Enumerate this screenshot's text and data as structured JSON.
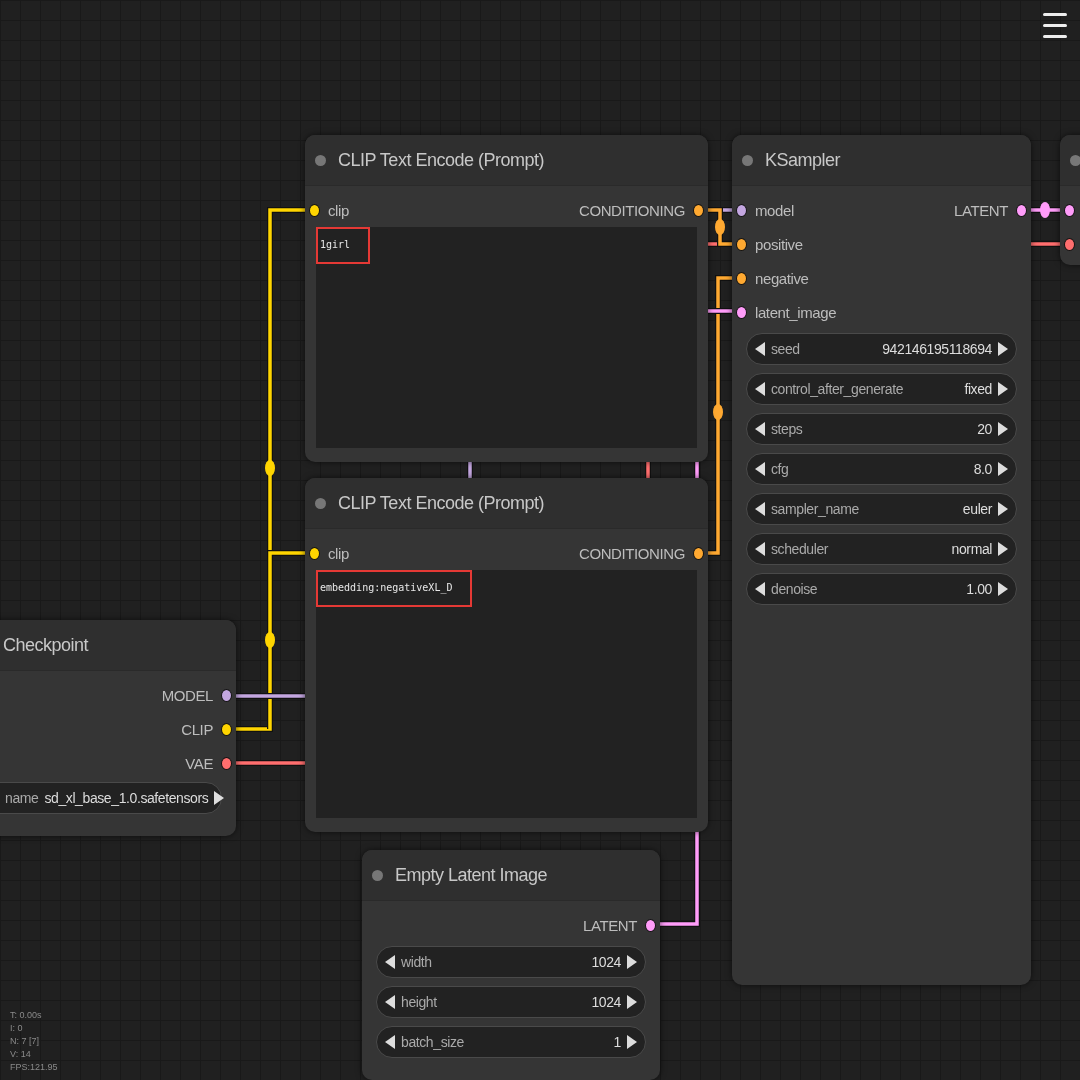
{
  "nodes": [
    {
      "title": "Checkpoint",
      "kind": "loader",
      "outputs": [
        {
          "name": "MODEL",
          "color": "#c3a6e0"
        },
        {
          "name": "CLIP",
          "color": "#ffd500"
        },
        {
          "name": "VAE",
          "color": "#ff6e6e"
        }
      ],
      "widgets": [
        {
          "label": "name",
          "value": "sd_xl_base_1.0.safetensors"
        }
      ]
    },
    {
      "title": "CLIP Text Encode (Prompt)",
      "kind": "prompt",
      "inputs": [
        {
          "name": "clip",
          "color": "#ffd500"
        }
      ],
      "outputs": [
        {
          "name": "CONDITIONING",
          "color": "#ffa931"
        }
      ],
      "text": "1girl",
      "highlighted": true
    },
    {
      "title": "CLIP Text Encode (Prompt)",
      "kind": "prompt",
      "inputs": [
        {
          "name": "clip",
          "color": "#ffd500"
        }
      ],
      "outputs": [
        {
          "name": "CONDITIONING",
          "color": "#ffa931"
        }
      ],
      "text": "embedding:negativeXL_D",
      "highlighted": true
    },
    {
      "title": "Empty Latent Image",
      "kind": "widgets",
      "outputs": [
        {
          "name": "LATENT",
          "color": "#ff9cf9"
        }
      ],
      "widgets": [
        {
          "label": "width",
          "value": "1024"
        },
        {
          "label": "height",
          "value": "1024"
        },
        {
          "label": "batch_size",
          "value": "1"
        }
      ]
    },
    {
      "title": "KSampler",
      "kind": "widgets",
      "inputs": [
        {
          "name": "model",
          "color": "#c3a6e0"
        },
        {
          "name": "positive",
          "color": "#ffa931"
        },
        {
          "name": "negative",
          "color": "#ffa931"
        },
        {
          "name": "latent_image",
          "color": "#ff9cf9"
        }
      ],
      "outputs": [
        {
          "name": "LATENT",
          "color": "#ff9cf9"
        }
      ],
      "widgets": [
        {
          "label": "seed",
          "value": "942146195118694"
        },
        {
          "label": "control_after_generate",
          "value": "fixed"
        },
        {
          "label": "steps",
          "value": "20"
        },
        {
          "label": "cfg",
          "value": "8.0"
        },
        {
          "label": "sampler_name",
          "value": "euler"
        },
        {
          "label": "scheduler",
          "value": "normal"
        },
        {
          "label": "denoise",
          "value": "1.00"
        }
      ]
    },
    {
      "kind": "partial",
      "inputs": [
        {
          "color": "#ff9cf9"
        },
        {
          "color": "#ff6e6e"
        }
      ]
    }
  ],
  "stats": [
    "T: 0.00s",
    "I: 0",
    "N: 7 [7]",
    "V: 14",
    "FPS:121.95"
  ]
}
